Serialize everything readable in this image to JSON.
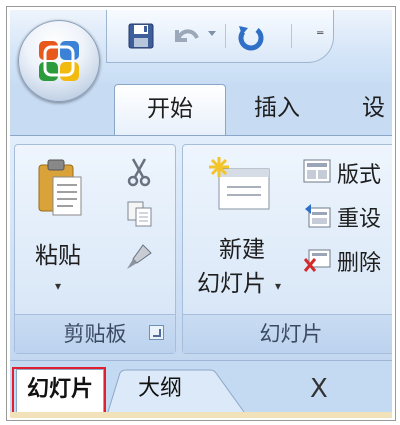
{
  "quick_access": {
    "icons": [
      "office-button-icon",
      "save-icon",
      "undo-icon",
      "undo-dropdown-icon",
      "redo-icon",
      "customize-qat-icon"
    ],
    "more_glyph": "⁼"
  },
  "tabs": [
    {
      "label": "开始"
    },
    {
      "label": "插入"
    },
    {
      "label": "设"
    }
  ],
  "ribbon": {
    "clipboard": {
      "paste_label": "粘贴",
      "group_label": "剪贴板",
      "icons": [
        "paste-icon",
        "cut-icon",
        "copy-icon",
        "format-painter-icon",
        "dialog-launcher-icon"
      ]
    },
    "slides": {
      "new_slide_label_1": "新建",
      "new_slide_label_2": "幻灯片",
      "layout_label": "版式",
      "reset_label": "重设",
      "delete_label": "删除",
      "group_label": "幻灯片",
      "icons": [
        "new-slide-icon",
        "layout-icon",
        "reset-icon",
        "delete-icon"
      ]
    }
  },
  "pane": {
    "tabs": [
      {
        "label": "幻灯片"
      },
      {
        "label": "大纲"
      }
    ],
    "close_glyph": "X"
  },
  "colors": {
    "ribbon_bg": "#cfe0f5",
    "highlight": "#e0202e"
  }
}
